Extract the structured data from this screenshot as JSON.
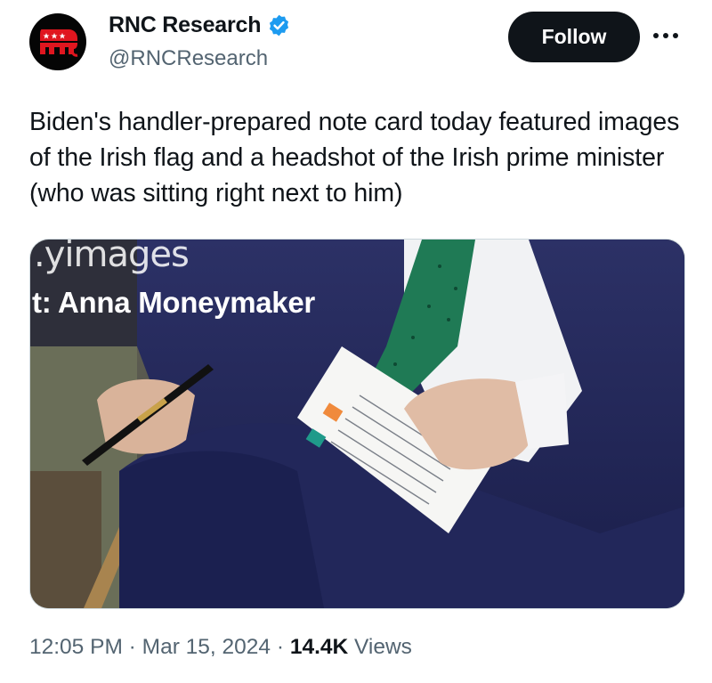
{
  "author": {
    "display_name": "RNC Research",
    "handle": "@RNCResearch",
    "verified": true,
    "avatar_icon": "gop-elephant-icon"
  },
  "actions": {
    "follow_label": "Follow",
    "more_icon": "more-dots-icon"
  },
  "tweet": {
    "text": "Biden's handler-prepared note card today featured images of the Irish flag and a headshot of the Irish prime minister (who was sitting right next to him)"
  },
  "media": {
    "watermark_line1": ".yimages",
    "watermark_line2": "t: Anna Moneymaker"
  },
  "meta": {
    "time": "12:05 PM",
    "separator": " · ",
    "date": "Mar 15, 2024",
    "views_count": "14.4K",
    "views_label": " Views"
  },
  "colors": {
    "text": "#0f1419",
    "secondary": "#536471",
    "verified_blue": "#1d9bf0",
    "gop_red": "#e0161f",
    "button_bg": "#0f1419"
  }
}
